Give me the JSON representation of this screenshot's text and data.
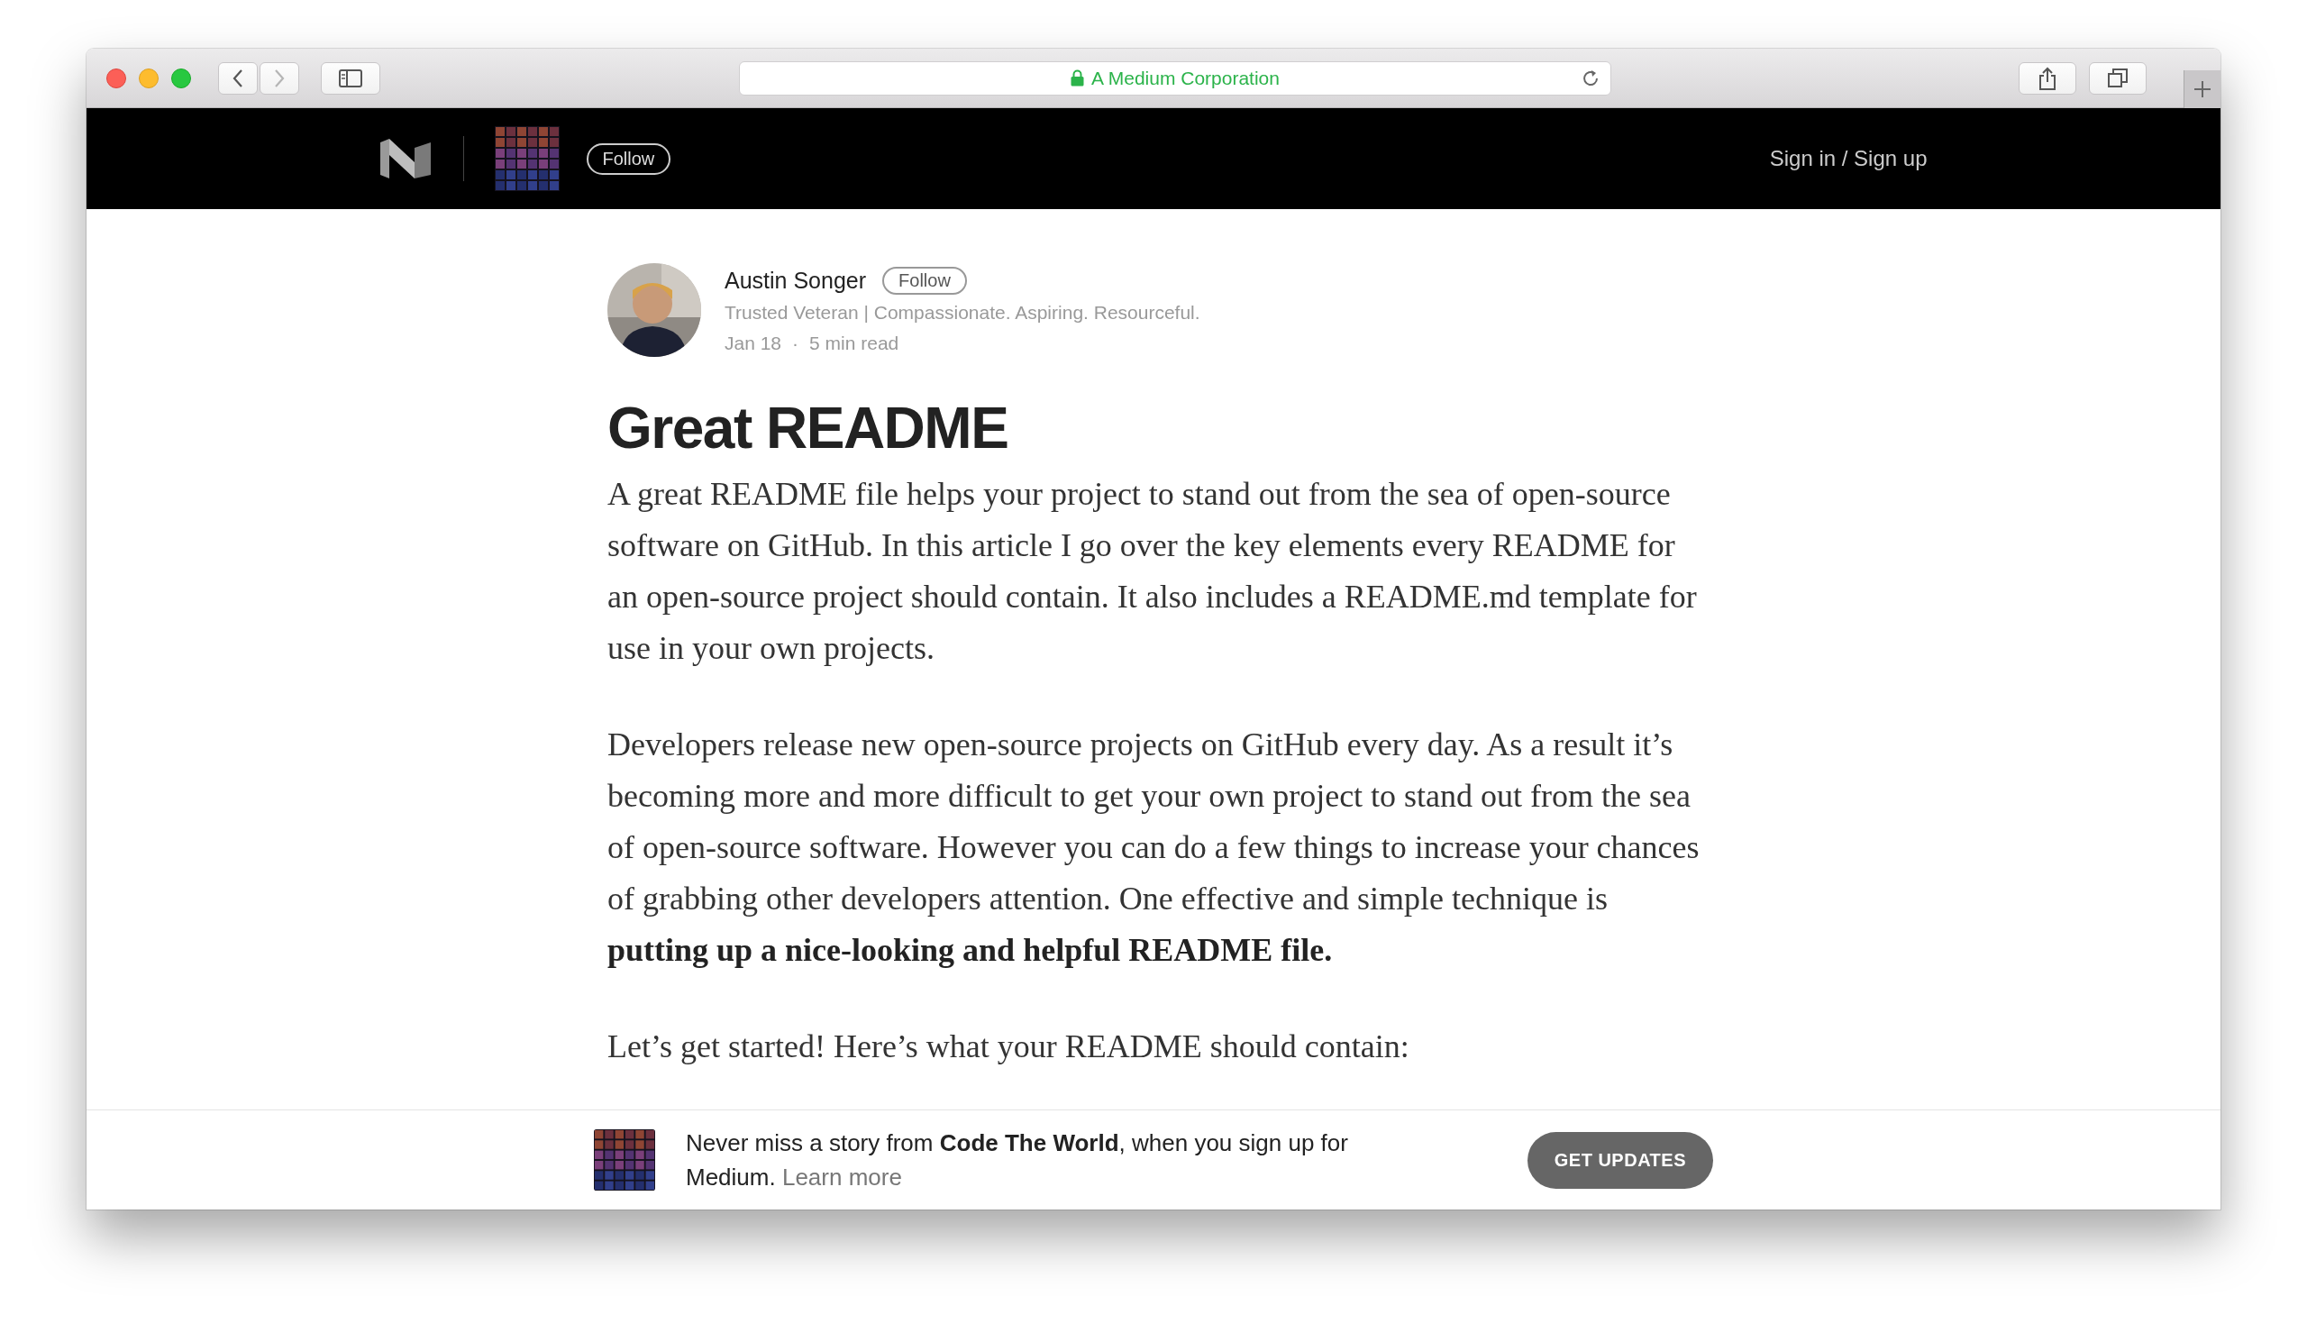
{
  "browser": {
    "address": "A Medium Corporation",
    "secure": true,
    "navigation": [
      {
        "kind": "back",
        "disabled": false
      },
      {
        "kind": "forward",
        "disabled": true
      }
    ]
  },
  "header": {
    "follow": "Follow",
    "sign_in": "Sign in / Sign up"
  },
  "author": {
    "name": "Austin Songer",
    "follow": "Follow",
    "bio": "Trusted Veteran | Compassionate. Aspiring. Resourceful.",
    "date": "Jan 18",
    "separator": "·",
    "read_time": "5 min read"
  },
  "article": {
    "title": "Great README",
    "paragraphs": [
      "A great README file helps your project to stand out from the sea of open-source software on GitHub. In this article I go over the key elements every README for an open-source project should contain. It also includes a README.md template for use in your own projects.",
      "Developers release new open-source projects on GitHub every day. As a result it’s becoming more and more difficult to get your own project to stand out from the sea of open-source software. However you can do a few things to increase your chances of grabbing other developers attention. One effective and simple technique is **putting up a nice-looking and helpful README file.**",
      "Let’s get started! Here’s what your README should contain:"
    ]
  },
  "banner": {
    "message": "Never miss a story from **Code The World**, when you sign up for Medium.",
    "link": "Learn more",
    "button": "GET UPDATES"
  }
}
